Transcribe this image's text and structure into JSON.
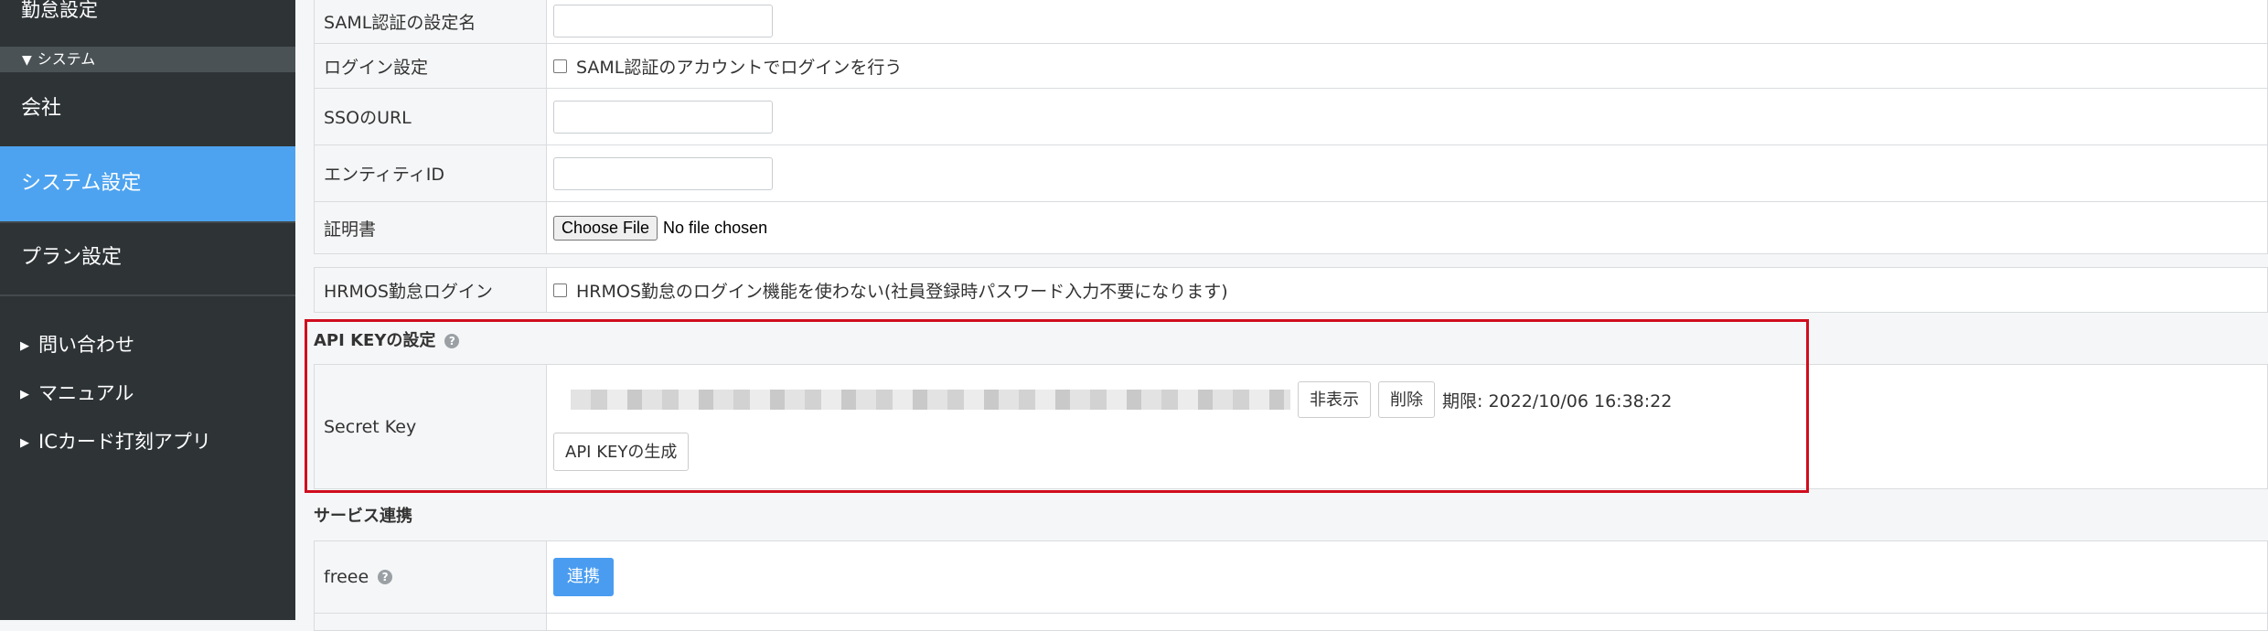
{
  "sidebar": {
    "top_item": "勤怠設定",
    "section": "システム",
    "items": {
      "company": "会社",
      "system_settings": "システム設定",
      "plan_settings": "プラン設定"
    },
    "links": [
      "問い合わせ",
      "マニュアル",
      "ICカード打刻アプリ"
    ]
  },
  "saml": {
    "setting_name_label": "SAML認証の設定名",
    "login_label": "ログイン設定",
    "login_checkbox": "SAML認証のアカウントでログインを行う",
    "sso_label": "SSOのURL",
    "entity_label": "エンティティID",
    "cert_label": "証明書",
    "file_button": "Choose File",
    "file_status": "No file chosen"
  },
  "hrmos": {
    "label": "HRMOS勤怠ログイン",
    "checkbox": "HRMOS勤怠のログイン機能を使わない(社員登録時パスワード入力不要になります)"
  },
  "api_key": {
    "title": "API KEYの設定",
    "secret_label": "Secret Key",
    "hide_button": "非表示",
    "delete_button": "削除",
    "expiry": "期限: 2022/10/06 16:38:22",
    "generate_button": "API KEYの生成"
  },
  "services": {
    "title": "サービス連携",
    "freee_label": "freee",
    "connect_button": "連携"
  },
  "colors": {
    "sidebar_bg": "#2e3336",
    "active_item": "#4da3f0",
    "highlight_border": "#d00d1e",
    "primary_button": "#4a9cf0"
  }
}
